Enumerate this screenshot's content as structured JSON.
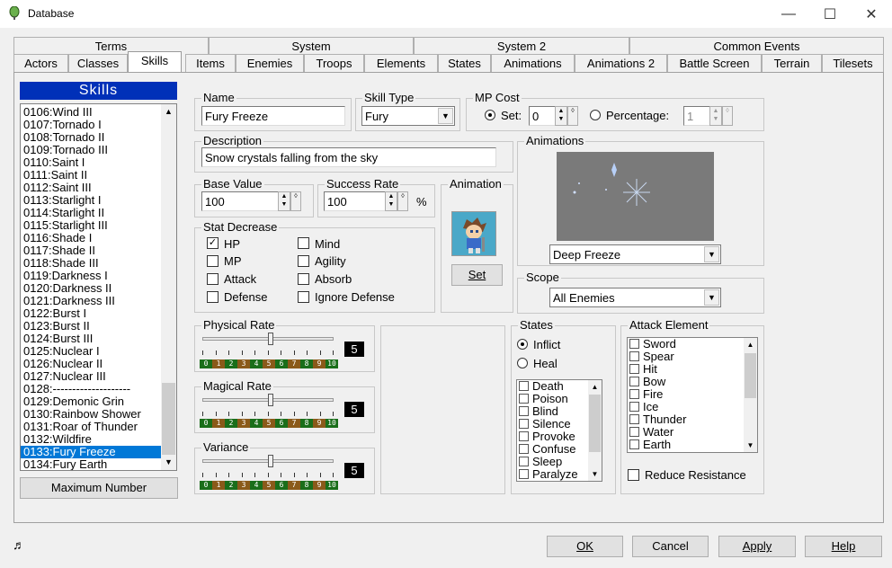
{
  "window": {
    "title": "Database",
    "minimize": "—",
    "maximize": "☐",
    "close": "✕"
  },
  "tabs_row1": [
    "Terms",
    "System",
    "System 2",
    "Common Events"
  ],
  "tabs_row2": [
    "Actors",
    "Classes",
    "Skills",
    "Items",
    "Enemies",
    "Troops",
    "Elements",
    "States",
    "Animations",
    "Animations 2",
    "Battle Screen",
    "Terrain",
    "Tilesets"
  ],
  "active_tab": "Skills",
  "skills_list": {
    "header": "Skills",
    "items": [
      "0106:Wind III",
      "0107:Tornado I",
      "0108:Tornado II",
      "0109:Tornado III",
      "0110:Saint I",
      "0111:Saint II",
      "0112:Saint III",
      "0113:Starlight I",
      "0114:Starlight II",
      "0115:Starlight III",
      "0116:Shade I",
      "0117:Shade II",
      "0118:Shade III",
      "0119:Darkness I",
      "0120:Darkness II",
      "0121:Darkness III",
      "0122:Burst I",
      "0123:Burst II",
      "0124:Burst III",
      "0125:Nuclear I",
      "0126:Nuclear II",
      "0127:Nuclear III",
      "0128:--------------------",
      "0129:Demonic Grin",
      "0130:Rainbow Shower",
      "0131:Roar of Thunder",
      "0132:Wildfire",
      "0133:Fury Freeze",
      "0134:Fury Earth"
    ],
    "selected": "0133:Fury Freeze",
    "max_button": "Maximum Number"
  },
  "name": {
    "label": "Name",
    "value": "Fury Freeze"
  },
  "skill_type": {
    "label": "Skill Type",
    "value": "Fury"
  },
  "mp_cost": {
    "label": "MP Cost",
    "set_label": "Set:",
    "set_value": "0",
    "percentage_label": "Percentage:",
    "percentage_value": "1"
  },
  "description": {
    "label": "Description",
    "value": "Snow crystals falling from the sky"
  },
  "base_value": {
    "label": "Base Value",
    "value": "100"
  },
  "success_rate": {
    "label": "Success Rate",
    "value": "100",
    "unit": "%"
  },
  "animation": {
    "label": "Animation",
    "set_button": "Set"
  },
  "stat_decrease": {
    "label": "Stat Decrease",
    "items": [
      {
        "label": "HP",
        "checked": true
      },
      {
        "label": "MP",
        "checked": false
      },
      {
        "label": "Attack",
        "checked": false
      },
      {
        "label": "Defense",
        "checked": false
      },
      {
        "label": "Mind",
        "checked": false
      },
      {
        "label": "Agility",
        "checked": false
      },
      {
        "label": "Absorb",
        "checked": false
      },
      {
        "label": "Ignore Defense",
        "checked": false
      }
    ]
  },
  "animations": {
    "label": "Animations",
    "value": "Deep Freeze"
  },
  "scope": {
    "label": "Scope",
    "value": "All Enemies"
  },
  "physical_rate": {
    "label": "Physical Rate",
    "value": "5"
  },
  "magical_rate": {
    "label": "Magical Rate",
    "value": "5"
  },
  "variance": {
    "label": "Variance",
    "value": "5"
  },
  "scale_numbers": [
    "0",
    "1",
    "2",
    "3",
    "4",
    "5",
    "6",
    "7",
    "8",
    "9",
    "10"
  ],
  "states": {
    "label": "States",
    "inflict": "Inflict",
    "heal": "Heal",
    "items": [
      "Death",
      "Poison",
      "Blind",
      "Silence",
      "Provoke",
      "Confuse",
      "Sleep",
      "Paralyze"
    ]
  },
  "attack_element": {
    "label": "Attack Element",
    "items": [
      "Sword",
      "Spear",
      "Hit",
      "Bow",
      "Fire",
      "Ice",
      "Thunder",
      "Water",
      "Earth"
    ],
    "reduce_resistance": "Reduce Resistance"
  },
  "footer": {
    "ok": "OK",
    "cancel": "Cancel",
    "apply": "Apply",
    "help": "Help"
  },
  "colors": {
    "header_blue": "#0030b8",
    "selection": "#0078d7",
    "scale_green": "#1a6e1a",
    "scale_brown": "#8a5a1a"
  }
}
